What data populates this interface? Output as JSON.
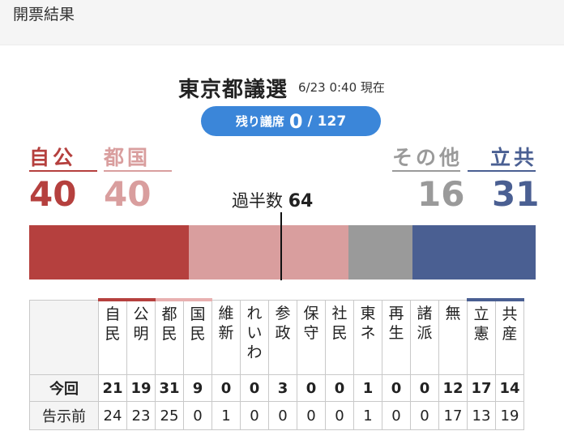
{
  "header": {
    "title": "開票結果"
  },
  "election": {
    "title": "東京都議選",
    "updated": "6/23 0:40 現在"
  },
  "remaining": {
    "label": "残り議席",
    "value": "0",
    "total": "/ 127"
  },
  "groups": [
    {
      "name": "自公",
      "seats": "40",
      "color": "#b5403e"
    },
    {
      "name": "都国",
      "seats": "40",
      "color": "#d99e9e"
    },
    {
      "name": "その他",
      "seats": "16",
      "color": "#9a9a9a"
    },
    {
      "name": "立共",
      "seats": "31",
      "color": "#4a5f92"
    }
  ],
  "majority": {
    "label": "過半数",
    "value": "64"
  },
  "bar_segments": [
    {
      "group": "自公",
      "seats": 40,
      "color": "#b5403e"
    },
    {
      "group": "都国",
      "seats": 40,
      "color": "#d99e9e"
    },
    {
      "group": "その他",
      "seats": 16,
      "color": "#9a9a9a"
    },
    {
      "group": "立共",
      "seats": 31,
      "color": "#4a5f92"
    }
  ],
  "table": {
    "row_now": "今回",
    "row_prev": "告示前",
    "parties": [
      {
        "name": "自\n民",
        "now": "21",
        "prev": "24",
        "accent": "#b5403e"
      },
      {
        "name": "公\n明",
        "now": "19",
        "prev": "23",
        "accent": "#b5403e"
      },
      {
        "name": "都\n民",
        "now": "31",
        "prev": "25",
        "accent": "#e8b0b0"
      },
      {
        "name": "国\n民",
        "now": "9",
        "prev": "0",
        "accent": "#e8b0b0"
      },
      {
        "name": "維\n新",
        "now": "0",
        "prev": "1",
        "accent": ""
      },
      {
        "name": "れ\nい\nわ",
        "now": "0",
        "prev": "0",
        "accent": ""
      },
      {
        "name": "参\n政",
        "now": "3",
        "prev": "0",
        "accent": ""
      },
      {
        "name": "保\n守",
        "now": "0",
        "prev": "0",
        "accent": ""
      },
      {
        "name": "社\n民",
        "now": "0",
        "prev": "0",
        "accent": ""
      },
      {
        "name": "東\nネ",
        "now": "1",
        "prev": "1",
        "accent": ""
      },
      {
        "name": "再\n生",
        "now": "0",
        "prev": "0",
        "accent": ""
      },
      {
        "name": "諸\n派",
        "now": "0",
        "prev": "0",
        "accent": ""
      },
      {
        "name": "無",
        "now": "12",
        "prev": "17",
        "accent": ""
      },
      {
        "name": "立\n憲",
        "now": "17",
        "prev": "13",
        "accent": "#4a5f92"
      },
      {
        "name": "共\n産",
        "now": "14",
        "prev": "19",
        "accent": "#4a5f92"
      }
    ]
  }
}
